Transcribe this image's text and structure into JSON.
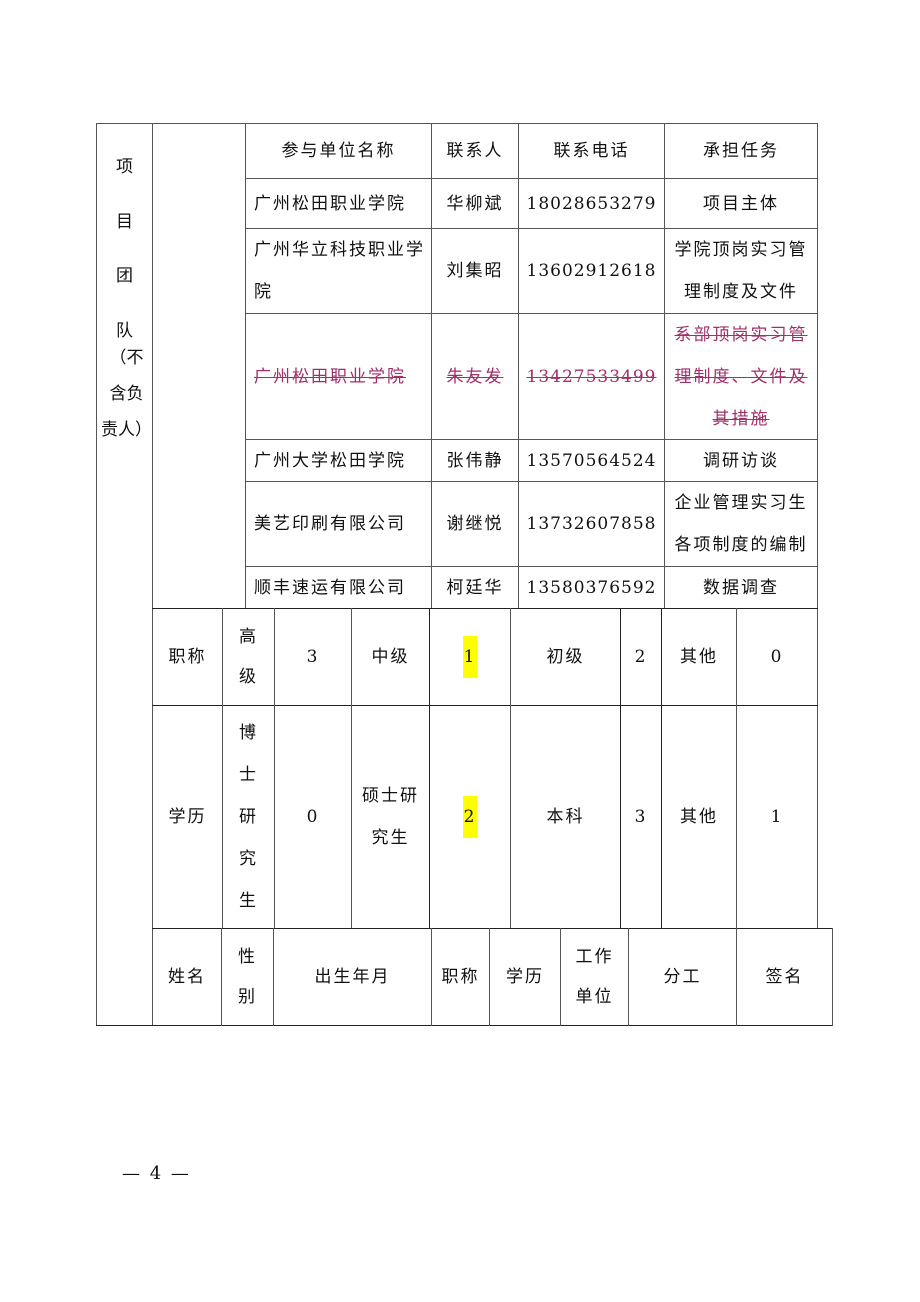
{
  "team_section": {
    "label_chars": [
      "项",
      "目",
      "团",
      "队",
      "（不",
      "含负",
      "责人）"
    ],
    "header": {
      "unit_name": "参与单位名称",
      "contact": "联系人",
      "phone": "联系电话",
      "task": "承担任务"
    },
    "rows": [
      {
        "unit": "广州松田职业学院",
        "contact": "华柳斌",
        "phone": "18028653279",
        "task": "项目主体",
        "struck": false
      },
      {
        "unit": "广州华立科技职业学院",
        "contact": "刘集昭",
        "phone": "13602912618",
        "task": "学院顶岗实习管理制度及文件",
        "struck": false
      },
      {
        "unit": "广州松田职业学院",
        "contact": "朱友发",
        "phone": "13427533499",
        "task": "系部顶岗实习管理制度、文件及其措施",
        "struck": true
      },
      {
        "unit": "广州大学松田学院",
        "contact": "张伟静",
        "phone": "13570564524",
        "task": "调研访谈",
        "struck": false
      },
      {
        "unit": "美艺印刷有限公司",
        "contact": "谢继悦",
        "phone": "13732607858",
        "task": "企业管理实习生各项制度的编制",
        "struck": false
      },
      {
        "unit": "顺丰速运有限公司",
        "contact": "柯廷华",
        "phone": "13580376592",
        "task": "数据调查",
        "struck": false
      }
    ]
  },
  "title_row": {
    "label": "职称",
    "senior_label": "高级",
    "senior": "3",
    "middle_label": "中级",
    "middle": "1",
    "junior_label": "初级",
    "junior": "2",
    "other_label": "其他",
    "other": "0"
  },
  "education_row": {
    "label": "学历",
    "phd_label": "博士研究生",
    "phd": "0",
    "master_label": "硕士研究生",
    "master": "2",
    "bachelor_label": "本科",
    "bachelor": "3",
    "other_label": "其他",
    "other": "1"
  },
  "member_header": {
    "name": "姓名",
    "gender": "性别",
    "birth": "出生年月",
    "title": "职称",
    "education": "学历",
    "workplace": "工作单位",
    "division": "分工",
    "signature": "签名"
  },
  "footer": {
    "page_number": "— 4 —"
  },
  "colors": {
    "strike": "#a0306a",
    "highlight": "#ffff00"
  }
}
